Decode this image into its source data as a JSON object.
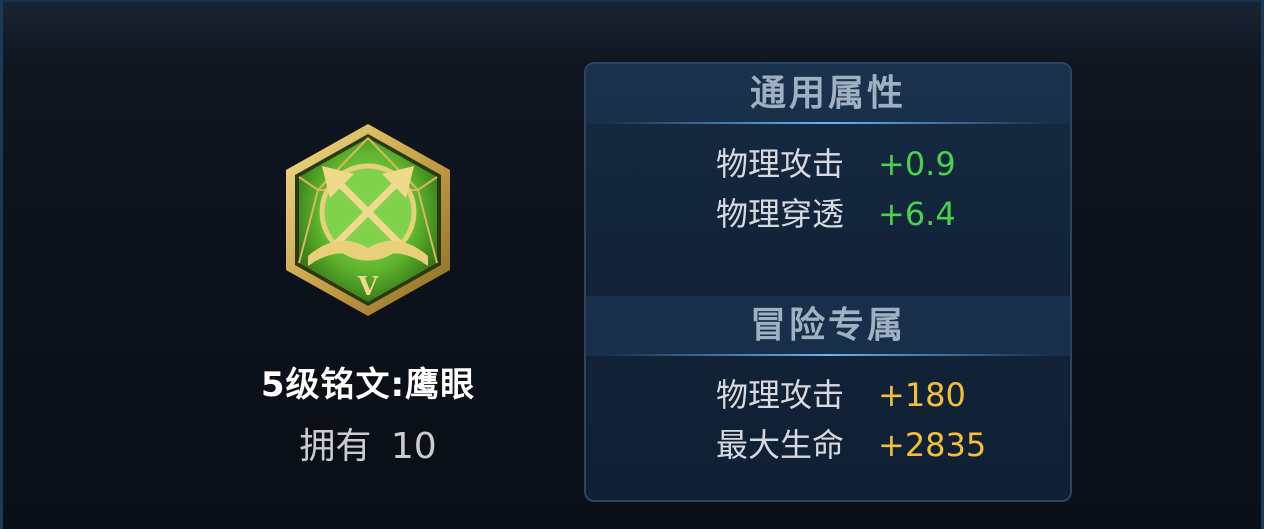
{
  "item": {
    "name": "5级铭文:鹰眼",
    "owned_label": "拥有",
    "owned_count": "10",
    "tier_numeral": "V",
    "icon": "hawk-eye-rune-icon"
  },
  "general": {
    "title": "通用属性",
    "stats": [
      {
        "label": "物理攻击",
        "value": "+0.9"
      },
      {
        "label": "物理穿透",
        "value": "+6.4"
      }
    ]
  },
  "adventure": {
    "title": "冒险专属",
    "stats": [
      {
        "label": "物理攻击",
        "value": "+180"
      },
      {
        "label": "最大生命",
        "value": "+2835"
      }
    ]
  },
  "colors": {
    "general_value": "#49d24a",
    "adventure_value": "#f3bf3a",
    "emblem_green": "#5fb52e",
    "emblem_gold": "#c9a24a"
  }
}
